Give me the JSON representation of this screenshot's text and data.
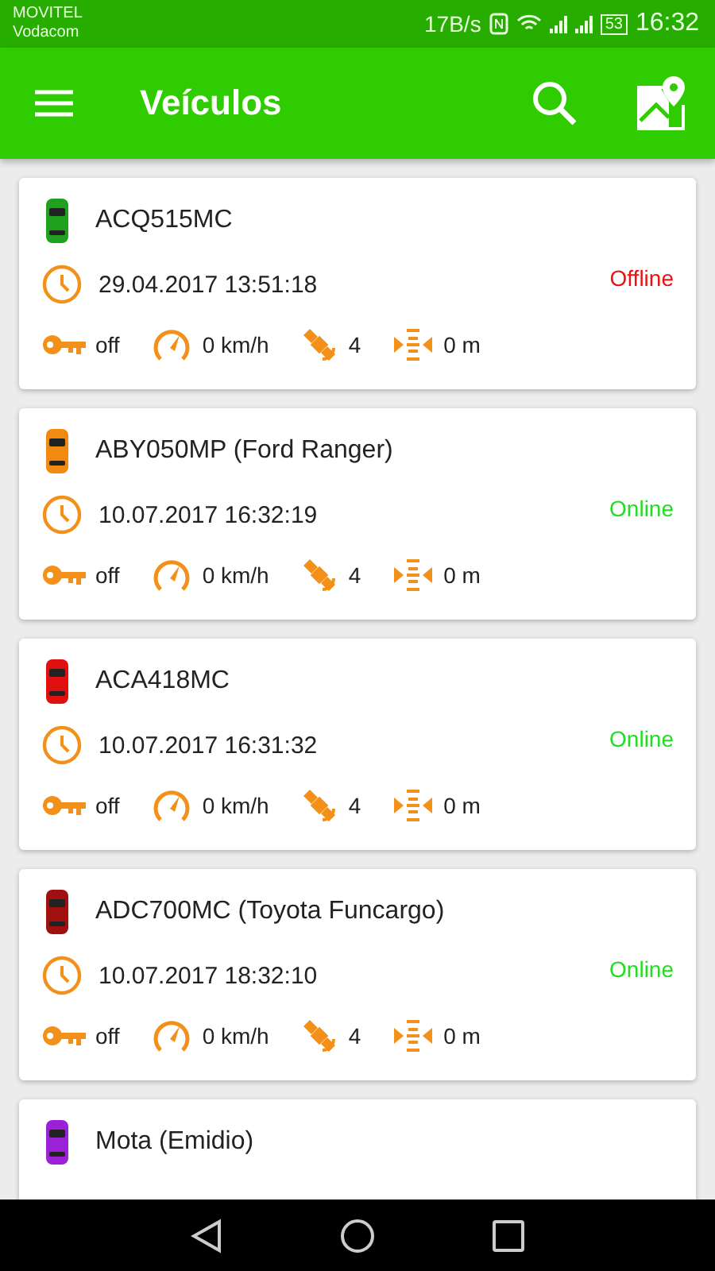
{
  "status_bar": {
    "carriers": [
      "MOVITEL",
      "Vodacom"
    ],
    "speed": "17B/s",
    "battery": "53",
    "time": "16:32"
  },
  "app_bar": {
    "title": "Veículos"
  },
  "vehicles": [
    {
      "name": "ACQ515MC",
      "color": "#1fa01f",
      "timestamp": "29.04.2017 13:51:18",
      "status": "Offline",
      "online": false,
      "ignition": "off",
      "speed": "0 km/h",
      "satellites": "4",
      "distance": "0 m"
    },
    {
      "name": "ABY050MP (Ford Ranger)",
      "color": "#f08a10",
      "timestamp": "10.07.2017 16:32:19",
      "status": "Online",
      "online": true,
      "ignition": "off",
      "speed": "0 km/h",
      "satellites": "4",
      "distance": "0 m"
    },
    {
      "name": "ACA418MC",
      "color": "#e01010",
      "timestamp": "10.07.2017 16:31:32",
      "status": "Online",
      "online": true,
      "ignition": "off",
      "speed": "0 km/h",
      "satellites": "4",
      "distance": "0 m"
    },
    {
      "name": "ADC700MC (Toyota Funcargo)",
      "color": "#a01010",
      "timestamp": "10.07.2017 18:32:10",
      "status": "Online",
      "online": true,
      "ignition": "off",
      "speed": "0 km/h",
      "satellites": "4",
      "distance": "0 m"
    },
    {
      "name": "Mota (Emidio)",
      "color": "#9b20d8"
    }
  ]
}
